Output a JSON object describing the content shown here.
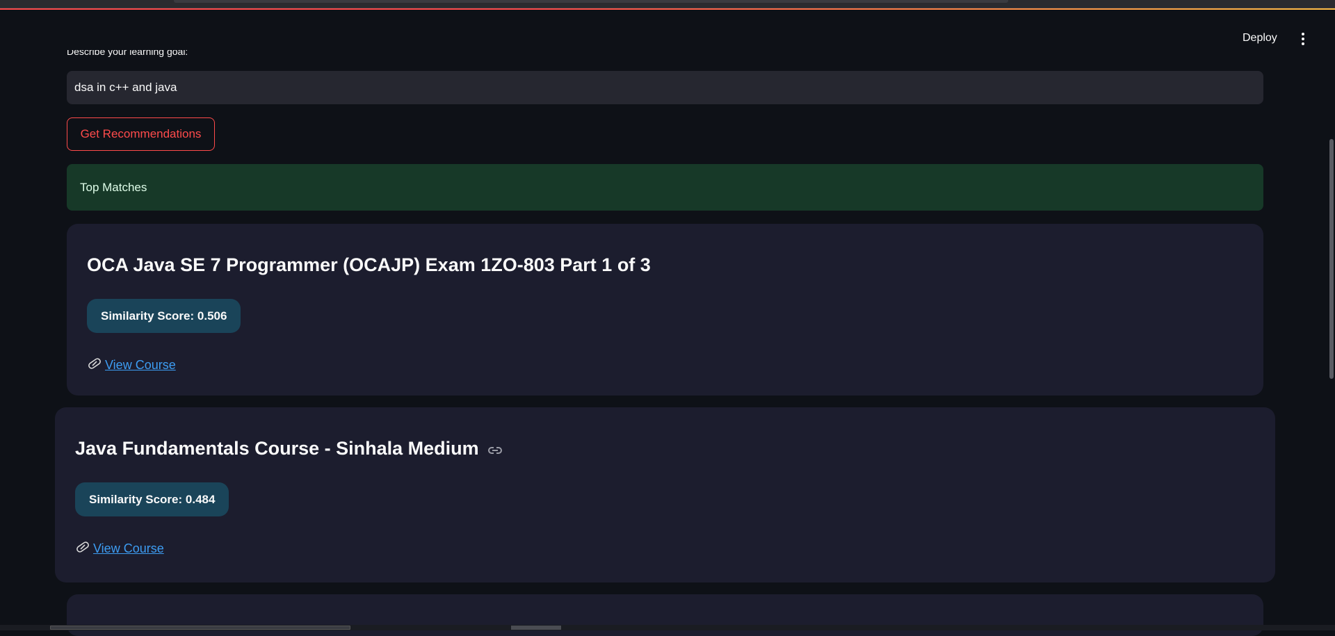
{
  "header": {
    "deploy_label": "Deploy",
    "menu_icon": "more-vertical-icon"
  },
  "form": {
    "goal_label": "Describe your learning goal:",
    "goal_value": "dsa in c++ and java",
    "button_label": "Get Recommendations"
  },
  "results": {
    "heading": "Top Matches",
    "courses": [
      {
        "title": "OCA Java SE 7 Programmer (OCAJP) Exam 1ZO-803 Part 1 of 3",
        "score_text": "Similarity Score: 0.506",
        "link_label": " View Course",
        "link_icon": "paperclip-icon"
      },
      {
        "title": "Java Fundamentals Course - Sinhala Medium",
        "score_text": "Similarity Score: 0.484",
        "link_label": " View Course",
        "link_icon": "paperclip-icon",
        "anchor_icon": "link-icon"
      }
    ]
  },
  "colors": {
    "background": "#0e1117",
    "accent": "#ff4b4b",
    "success_bg": "#173928",
    "card_bg": "#1c1d2e",
    "badge_bg": "#1a4459",
    "link": "#3d9df3"
  }
}
